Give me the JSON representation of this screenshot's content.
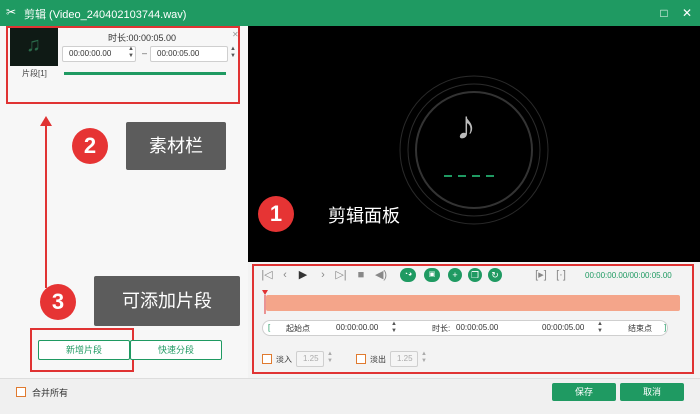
{
  "window": {
    "title": "剪辑 (Video_240402103744.wav)"
  },
  "material": {
    "duration_label": "时长:",
    "duration_value": "00:00:05.00",
    "start_time": "00:00:00.00",
    "dash": "–",
    "end_time": "00:00:05.00",
    "segment_label": "片段[1]"
  },
  "left_buttons": {
    "add_segment": "新增片段",
    "quick_split": "快速分段"
  },
  "callouts": {
    "one": {
      "num": "1",
      "text": "剪辑面板"
    },
    "two": {
      "num": "2",
      "text": "素材栏"
    },
    "three": {
      "num": "3",
      "text": "可添加片段"
    }
  },
  "controls": {
    "time_readout": "00:00:00.00/00:00:05.00",
    "start_point": "起始点",
    "start_value": "00:00:00.00",
    "duration_label": "时长:",
    "duration_value": "00:00:05.00",
    "end_value": "00:00:05.00",
    "end_point": "结束点",
    "fade_in": "淡入",
    "fade_in_value": "1.25",
    "fade_out": "淡出",
    "fade_out_value": "1.25"
  },
  "footer": {
    "merge_all": "合并所有",
    "save": "保存",
    "cancel": "取消"
  },
  "colors": {
    "brand_green": "#1f9a62",
    "callout_red": "#e63434",
    "timeline_orange": "#f4a58a"
  }
}
